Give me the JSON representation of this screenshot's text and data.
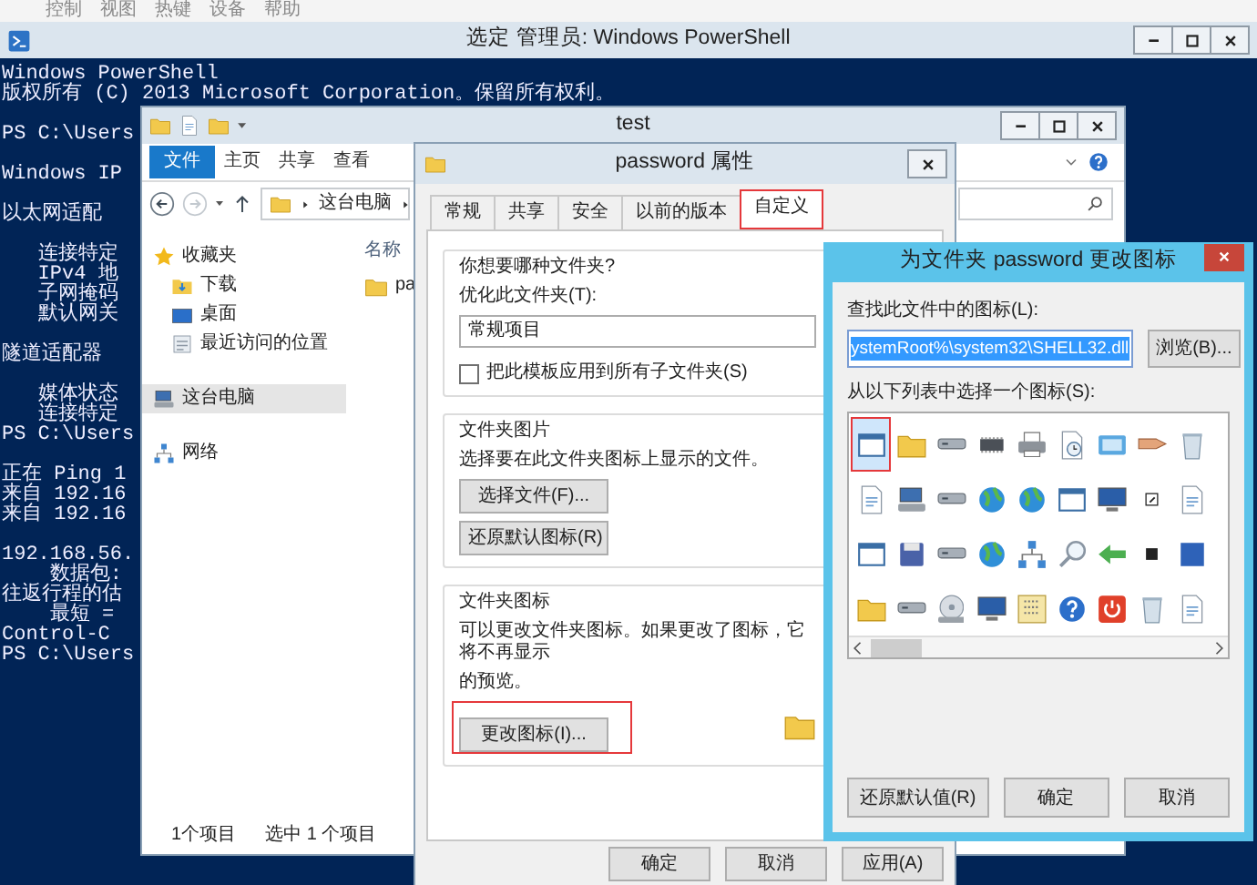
{
  "host_menu": [
    "控制",
    "视图",
    "热键",
    "设备",
    "帮助"
  ],
  "powershell": {
    "title": "选定 管理员: Windows PowerShell",
    "console_blocks": [
      [
        "Windows PowerShell",
        "版权所有 (C) 2013 Microsoft Corporation。保留所有权利。"
      ],
      [
        "PS C:\\Users"
      ],
      [
        "Windows IP"
      ],
      [
        "以太网适配"
      ],
      [
        "   连接特定",
        "   IPv4 地",
        "   子网掩码",
        "   默认网关"
      ],
      [
        "隧道适配器"
      ],
      [
        "   媒体状态",
        "   连接特定",
        "PS C:\\Users"
      ],
      [
        "正在 Ping 1",
        "来自 192.16",
        "来自 192.16"
      ],
      [
        "192.168.56.",
        "    数据包:",
        "往返行程的估",
        "    最短 =",
        "Control-C",
        "PS C:\\Users"
      ]
    ]
  },
  "explorer": {
    "title": "test",
    "ribbon_tabs": [
      {
        "label": "文件",
        "selected": true
      },
      {
        "label": "主页",
        "selected": false
      },
      {
        "label": "共享",
        "selected": false
      },
      {
        "label": "查看",
        "selected": false
      }
    ],
    "address_path": "这台电脑",
    "nav_items": [
      {
        "label": "收藏夹",
        "kind": "star",
        "selected": false,
        "children": [
          {
            "label": "下载",
            "kind": "download",
            "selected": false
          },
          {
            "label": "桌面",
            "kind": "desktop",
            "selected": false
          },
          {
            "label": "最近访问的位置",
            "kind": "recent",
            "selected": false
          }
        ]
      },
      {
        "label": "这台电脑",
        "kind": "computer",
        "selected": true
      },
      {
        "label": "网络",
        "kind": "network",
        "selected": false
      }
    ],
    "column_header": "名称",
    "files": [
      {
        "name": "pa",
        "selected": false
      }
    ],
    "status_items": [
      "1个项目",
      "选中 1 个项目"
    ]
  },
  "properties": {
    "title": "password 属性",
    "tabs": [
      {
        "label": "常规",
        "selected": false,
        "highlighted": false
      },
      {
        "label": "共享",
        "selected": false,
        "highlighted": false
      },
      {
        "label": "安全",
        "selected": false,
        "highlighted": false
      },
      {
        "label": "以前的版本",
        "selected": false,
        "highlighted": false
      },
      {
        "label": "自定义",
        "selected": true,
        "highlighted": true
      }
    ],
    "folder_type": {
      "heading": "你想要哪种文件夹?",
      "label": "优化此文件夹(T):",
      "value": "常规项目",
      "checkbox": {
        "label": "把此模板应用到所有子文件夹(S)",
        "checked": false
      }
    },
    "folder_pictures": {
      "heading": "文件夹图片",
      "text_lines": [
        "选择要在此文件夹图标上显示的文件。"
      ],
      "buttons": [
        {
          "label": "选择文件(F)...",
          "highlighted": false
        },
        {
          "label": "还原默认图标(R)",
          "highlighted": false
        }
      ]
    },
    "folder_icons": {
      "heading": "文件夹图标",
      "text_lines": [
        "可以更改文件夹图标。如果更改了图标，它将不再显示",
        "的预览。"
      ],
      "buttons": [
        {
          "label": "更改图标(I)...",
          "highlighted": true
        }
      ]
    },
    "footer_buttons": [
      "确定",
      "取消",
      "应用(A)"
    ]
  },
  "change_icon": {
    "title": "为文件夹 password 更改图标",
    "file_label": "查找此文件中的图标(L):",
    "file_value": "ystemRoot%\\system32\\SHELL32.dll",
    "browse": "浏览(B)...",
    "list_label": "从以下列表中选择一个图标(S):",
    "icons": [
      {
        "kind": "window",
        "selected": true
      },
      {
        "kind": "folder",
        "selected": false
      },
      {
        "kind": "drive",
        "selected": false
      },
      {
        "kind": "chip",
        "selected": false
      },
      {
        "kind": "printer",
        "selected": false
      },
      {
        "kind": "clock",
        "selected": false
      },
      {
        "kind": "screen",
        "selected": false
      },
      {
        "kind": "pointer",
        "selected": false
      },
      {
        "kind": "trash",
        "selected": false
      },
      {
        "kind": "document",
        "selected": false
      },
      {
        "kind": "computer",
        "selected": false
      },
      {
        "kind": "drive",
        "selected": false
      },
      {
        "kind": "globe",
        "selected": false
      },
      {
        "kind": "globe",
        "selected": false
      },
      {
        "kind": "window",
        "selected": false
      },
      {
        "kind": "monitor",
        "selected": false
      },
      {
        "kind": "shortcut",
        "selected": false
      },
      {
        "kind": "document",
        "selected": false
      },
      {
        "kind": "window",
        "selected": false
      },
      {
        "kind": "floppy",
        "selected": false
      },
      {
        "kind": "drive",
        "selected": false
      },
      {
        "kind": "globe",
        "selected": false
      },
      {
        "kind": "network",
        "selected": false
      },
      {
        "kind": "magnifier",
        "selected": false
      },
      {
        "kind": "arrow",
        "selected": false
      },
      {
        "kind": "mark",
        "selected": false
      },
      {
        "kind": "tile",
        "selected": false
      },
      {
        "kind": "folder",
        "selected": false
      },
      {
        "kind": "drive",
        "selected": false
      },
      {
        "kind": "disc",
        "selected": false
      },
      {
        "kind": "monitor",
        "selected": false
      },
      {
        "kind": "grid",
        "selected": false
      },
      {
        "kind": "question",
        "selected": false
      },
      {
        "kind": "power",
        "selected": false
      },
      {
        "kind": "trash",
        "selected": false
      },
      {
        "kind": "document",
        "selected": false
      }
    ],
    "buttons": [
      "还原默认值(R)",
      "确定",
      "取消"
    ]
  }
}
